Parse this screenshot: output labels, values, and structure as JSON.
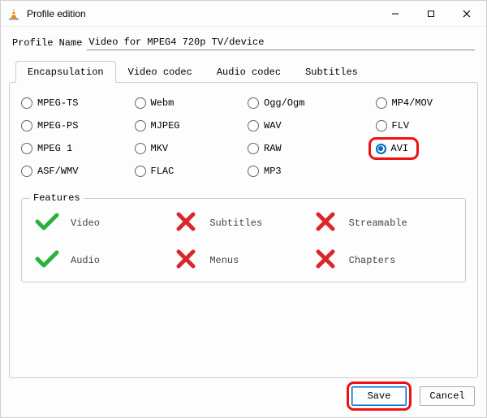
{
  "window": {
    "title": "Profile edition"
  },
  "profile": {
    "label": "Profile Name",
    "value": "Video for MPEG4 720p TV/device"
  },
  "tabs": [
    {
      "label": "Encapsulation",
      "active": true
    },
    {
      "label": "Video codec",
      "active": false
    },
    {
      "label": "Audio codec",
      "active": false
    },
    {
      "label": "Subtitles",
      "active": false
    }
  ],
  "formats": [
    {
      "label": "MPEG-TS",
      "selected": false
    },
    {
      "label": "Webm",
      "selected": false
    },
    {
      "label": "Ogg/Ogm",
      "selected": false
    },
    {
      "label": "MP4/MOV",
      "selected": false
    },
    {
      "label": "MPEG-PS",
      "selected": false
    },
    {
      "label": "MJPEG",
      "selected": false
    },
    {
      "label": "WAV",
      "selected": false
    },
    {
      "label": "FLV",
      "selected": false
    },
    {
      "label": "MPEG 1",
      "selected": false
    },
    {
      "label": "MKV",
      "selected": false
    },
    {
      "label": "RAW",
      "selected": false
    },
    {
      "label": "AVI",
      "selected": true,
      "highlight": true
    },
    {
      "label": "ASF/WMV",
      "selected": false
    },
    {
      "label": "FLAC",
      "selected": false
    },
    {
      "label": "MP3",
      "selected": false
    }
  ],
  "features": {
    "legend": "Features",
    "items": [
      {
        "label": "Video",
        "ok": true
      },
      {
        "label": "Subtitles",
        "ok": false
      },
      {
        "label": "Streamable",
        "ok": false
      },
      {
        "label": "Audio",
        "ok": true
      },
      {
        "label": "Menus",
        "ok": false
      },
      {
        "label": "Chapters",
        "ok": false
      }
    ]
  },
  "buttons": {
    "save": "Save",
    "cancel": "Cancel"
  }
}
